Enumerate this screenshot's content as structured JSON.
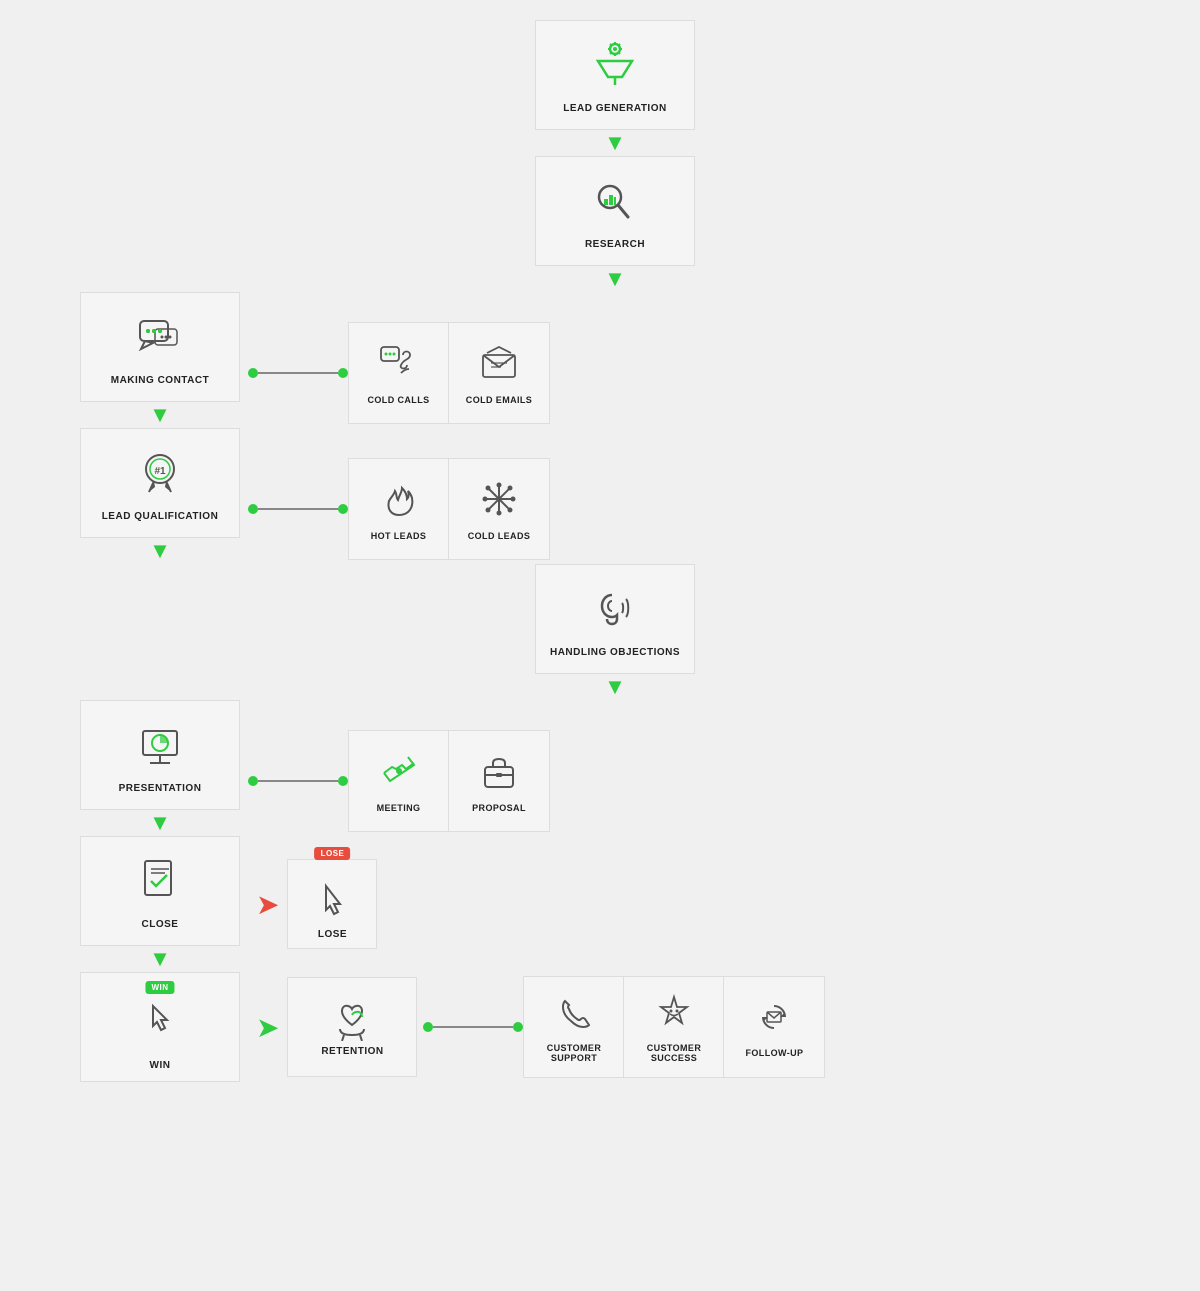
{
  "steps": [
    {
      "id": "lead-generation",
      "label": "LEAD GENERATION",
      "icon": "funnel"
    },
    {
      "id": "research",
      "label": "RESEARCH",
      "icon": "research"
    },
    {
      "id": "making-contact",
      "label": "MAKING CONTACT",
      "icon": "contact",
      "branch": [
        "COLD CALLS",
        "COLD EMAILS"
      ]
    },
    {
      "id": "lead-qualification",
      "label": "LEAD QUALIFICATION",
      "icon": "qualification",
      "branch": [
        "HOT LEADS",
        "COLD LEADS"
      ]
    },
    {
      "id": "handling-objections",
      "label": "HANDLING OBJECTIONS",
      "icon": "objections"
    },
    {
      "id": "presentation",
      "label": "PRESENTATION",
      "icon": "presentation",
      "branch": [
        "MEETING",
        "PROPOSAL"
      ]
    },
    {
      "id": "close",
      "label": "CLOSE",
      "icon": "close",
      "lose": "LOSE"
    },
    {
      "id": "win",
      "label": "WIN",
      "icon": "win",
      "win_badge": "WIN",
      "retention": "RETENTION",
      "after_branch": [
        "CUSTOMER SUPPORT",
        "CUSTOMER SUCCESS",
        "FOLLOW-UP"
      ]
    }
  ],
  "lose_label": "LOSE",
  "win_badge": "WIN",
  "lose_badge": "LOSE",
  "retention_label": "RETENTION"
}
